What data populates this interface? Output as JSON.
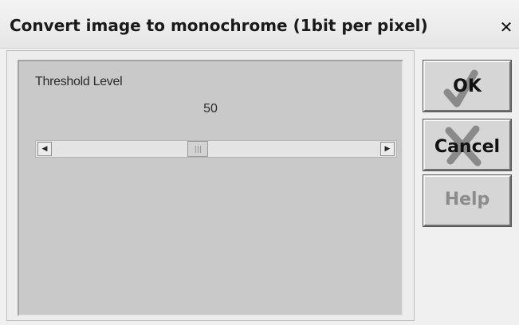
{
  "window": {
    "title": "Convert image to monochrome (1bit per pixel)",
    "close_icon": "close-icon"
  },
  "threshold": {
    "label": "Threshold Level",
    "value_text": "50",
    "value": 50,
    "min": 0,
    "max": 255
  },
  "scrollbar": {
    "left_arrow_icon": "left-arrow-icon",
    "right_arrow_icon": "right-arrow-icon"
  },
  "buttons": {
    "ok_label": "OK",
    "cancel_label": "Cancel",
    "help_label": "Help",
    "help_enabled": false
  },
  "colors": {
    "checkmark": "#8a8a8a",
    "cross": "#8a8a8a"
  }
}
